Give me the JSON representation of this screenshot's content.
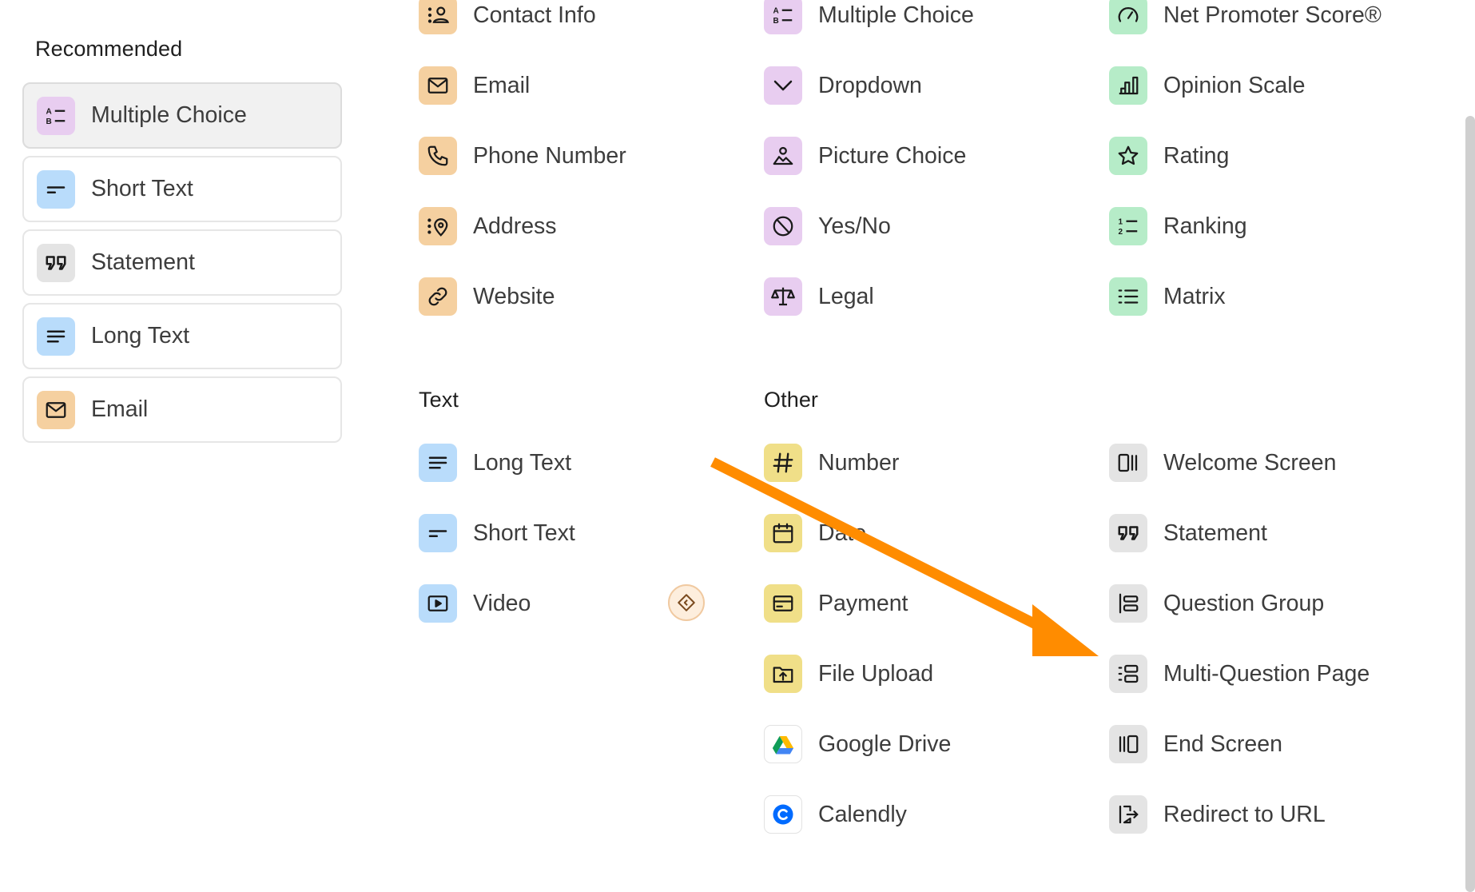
{
  "recommended": {
    "title": "Recommended",
    "items": [
      {
        "label": "Multiple Choice",
        "icon": "multiple-choice-icon",
        "selected": true
      },
      {
        "label": "Short Text",
        "icon": "short-text-icon"
      },
      {
        "label": "Statement",
        "icon": "quote-icon"
      },
      {
        "label": "Long Text",
        "icon": "long-text-icon"
      },
      {
        "label": "Email",
        "icon": "envelope-icon"
      }
    ]
  },
  "columns": {
    "contact": [
      {
        "label": "Contact Info",
        "icon": "contact-info-icon"
      },
      {
        "label": "Email",
        "icon": "envelope-icon"
      },
      {
        "label": "Phone Number",
        "icon": "phone-icon"
      },
      {
        "label": "Address",
        "icon": "map-pin-icon"
      },
      {
        "label": "Website",
        "icon": "link-icon"
      }
    ],
    "choice": [
      {
        "label": "Multiple Choice",
        "icon": "multiple-choice-icon"
      },
      {
        "label": "Dropdown",
        "icon": "chevron-down-icon"
      },
      {
        "label": "Picture Choice",
        "icon": "image-icon"
      },
      {
        "label": "Yes/No",
        "icon": "yes-no-icon"
      },
      {
        "label": "Legal",
        "icon": "scales-icon"
      }
    ],
    "rating": [
      {
        "label": "Net Promoter Score®",
        "icon": "gauge-icon"
      },
      {
        "label": "Opinion Scale",
        "icon": "bar-scale-icon"
      },
      {
        "label": "Rating",
        "icon": "star-icon"
      },
      {
        "label": "Ranking",
        "icon": "ranking-icon"
      },
      {
        "label": "Matrix",
        "icon": "matrix-icon"
      }
    ]
  },
  "text_section": {
    "title": "Text",
    "items": [
      {
        "label": "Long Text",
        "icon": "long-text-icon"
      },
      {
        "label": "Short Text",
        "icon": "short-text-icon"
      },
      {
        "label": "Video",
        "icon": "video-icon",
        "badge": "premium-gem-icon"
      }
    ]
  },
  "other_section": {
    "title": "Other",
    "left": [
      {
        "label": "Number",
        "icon": "hash-icon"
      },
      {
        "label": "Date",
        "icon": "calendar-icon"
      },
      {
        "label": "Payment",
        "icon": "credit-card-icon"
      },
      {
        "label": "File Upload",
        "icon": "file-upload-icon"
      },
      {
        "label": "Google Drive",
        "icon": "google-drive-icon"
      },
      {
        "label": "Calendly",
        "icon": "calendly-icon"
      }
    ],
    "right": [
      {
        "label": "Welcome Screen",
        "icon": "welcome-screen-icon"
      },
      {
        "label": "Statement",
        "icon": "quote-icon"
      },
      {
        "label": "Question Group",
        "icon": "question-group-icon"
      },
      {
        "label": "Multi-Question Page",
        "icon": "multi-question-icon"
      },
      {
        "label": "End Screen",
        "icon": "end-screen-icon"
      },
      {
        "label": "Redirect to URL",
        "icon": "redirect-icon"
      }
    ]
  },
  "annotation": {
    "color": "#ff8c00",
    "points_to": "Multi-Question Page"
  },
  "colors": {
    "contact": "#f5d0a0",
    "choice": "#e8cdf0",
    "rating": "#b6ecc8",
    "text": "#b9dcfb",
    "other": "#f0df88",
    "screens": "#e4e4e4"
  }
}
